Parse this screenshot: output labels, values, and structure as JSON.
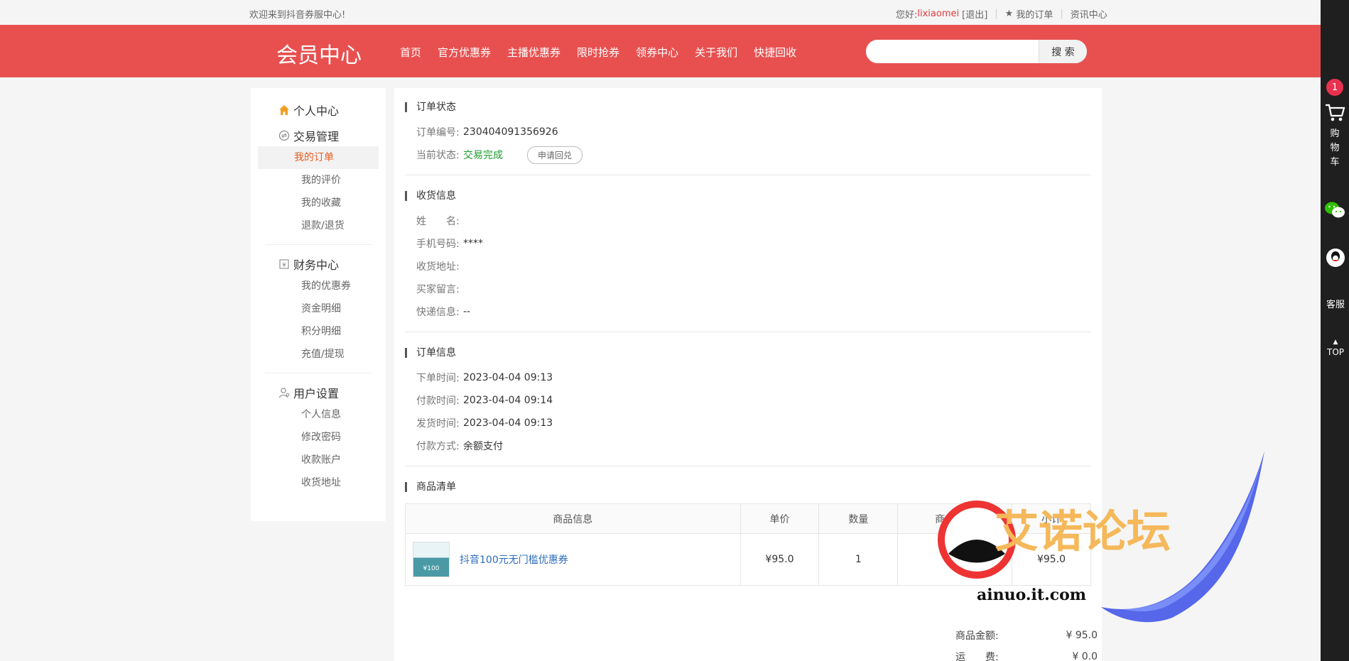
{
  "topbar": {
    "welcome": "欢迎来到抖音券服中心!",
    "greeting": "您好:",
    "username": "lixiaomei",
    "logout": "[退出]",
    "my_orders": "我的订单",
    "news": "资讯中心"
  },
  "header": {
    "logo": "会员中心",
    "nav": [
      "首页",
      "官方优惠券",
      "主播优惠券",
      "限时抢券",
      "领券中心",
      "关于我们",
      "快捷回收"
    ],
    "search_placeholder": "",
    "search_button": "搜 索"
  },
  "sidebar": {
    "groups": [
      {
        "title": "个人中心",
        "icon": "home-icon",
        "items": []
      },
      {
        "title": "交易管理",
        "icon": "exchange-icon",
        "items": [
          "我的订单",
          "我的评价",
          "我的收藏",
          "退款/退货"
        ],
        "active": "我的订单"
      },
      {
        "title": "财务中心",
        "icon": "finance-icon",
        "items": [
          "我的优惠券",
          "资金明细",
          "积分明细",
          "充值/提现"
        ]
      },
      {
        "title": "用户设置",
        "icon": "user-settings-icon",
        "items": [
          "个人信息",
          "修改密码",
          "收款账户",
          "收货地址"
        ]
      }
    ]
  },
  "order_status": {
    "title": "订单状态",
    "order_no_label": "订单编号:",
    "order_no": "230404091356926",
    "status_label": "当前状态:",
    "status": "交易完成",
    "apply_button": "申请回兑"
  },
  "shipping": {
    "title": "收货信息",
    "name_label": "姓　　名:",
    "name": "",
    "phone_label": "手机号码:",
    "phone": "****",
    "address_label": "收货地址:",
    "address": "",
    "message_label": "买家留言:",
    "message": "",
    "express_label": "快递信息:",
    "express": "--"
  },
  "order_info": {
    "title": "订单信息",
    "created_label": "下单时间:",
    "created": "2023-04-04 09:13",
    "paid_label": "付款时间:",
    "paid": "2023-04-04 09:14",
    "shipped_label": "发货时间:",
    "shipped": "2023-04-04 09:13",
    "pay_method_label": "付款方式:",
    "pay_method": "余额支付"
  },
  "goods": {
    "title": "商品清单",
    "headers": [
      "商品信息",
      "单价",
      "数量",
      "商品优惠",
      "小计"
    ],
    "rows": [
      {
        "name": "抖音100元无门槛优惠券",
        "thumb_text": "¥100",
        "price": "¥95.0",
        "qty": "1",
        "discount": "-",
        "subtotal": "¥95.0"
      }
    ]
  },
  "totals": {
    "goods_amount_label": "商品金额:",
    "goods_amount": "¥ 95.0",
    "shipping_label": "运　　费:",
    "shipping": "¥ 0.0"
  },
  "rightbar": {
    "cart_count": "1",
    "cart_label": "购物车",
    "service_label": "客服",
    "top_label": "TOP"
  },
  "watermark": {
    "title": "艾诺论坛",
    "url": "ainuo.it.com"
  }
}
